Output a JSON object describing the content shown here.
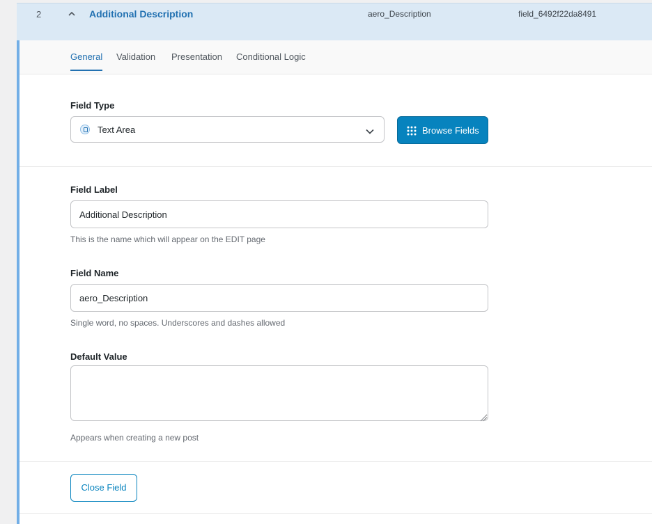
{
  "field_header": {
    "order": "2",
    "label": "Additional Description",
    "name": "aero_Description",
    "key": "field_6492f22da8491"
  },
  "tabs": [
    {
      "label": "General",
      "active": true
    },
    {
      "label": "Validation",
      "active": false
    },
    {
      "label": "Presentation",
      "active": false
    },
    {
      "label": "Conditional Logic",
      "active": false
    }
  ],
  "field_type": {
    "label": "Field Type",
    "selected": "Text Area",
    "browse_label": "Browse Fields"
  },
  "field_label": {
    "label": "Field Label",
    "value": "Additional Description",
    "description": "This is the name which will appear on the EDIT page"
  },
  "field_name": {
    "label": "Field Name",
    "value": "aero_Description",
    "description": "Single word, no spaces. Underscores and dashes allowed"
  },
  "default_value": {
    "label": "Default Value",
    "value": "",
    "description": "Appears when creating a new post"
  },
  "close_label": "Close Field",
  "colors": {
    "accent": "#2271b1",
    "primary_button": "#0783be",
    "header_bg": "#dbe9f5",
    "left_bar": "#72aee6"
  }
}
